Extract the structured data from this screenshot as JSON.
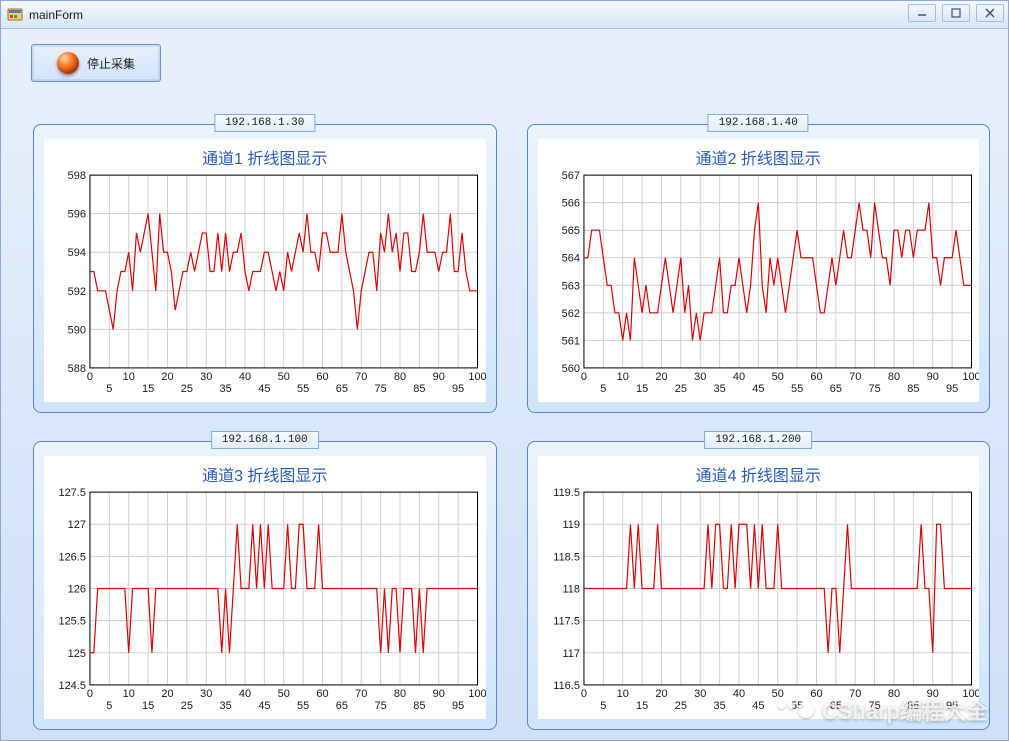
{
  "window": {
    "title": "mainForm"
  },
  "toolbar": {
    "stop_label": "停止采集"
  },
  "watermark": {
    "text": "CSharp编程大全"
  },
  "panels": [
    {
      "ip": "192.168.1.30",
      "title": "通道1 折线图显示"
    },
    {
      "ip": "192.168.1.40",
      "title": "通道2 折线图显示"
    },
    {
      "ip": "192.168.1.100",
      "title": "通道3 折线图显示"
    },
    {
      "ip": "192.168.1.200",
      "title": "通道4 折线图显示"
    }
  ],
  "chart_data": [
    {
      "type": "line",
      "title": "通道1 折线图显示",
      "xlabel": "",
      "ylabel": "",
      "xlim": [
        0,
        100
      ],
      "ylim": [
        588,
        598
      ],
      "x_ticks": [
        0,
        5,
        10,
        15,
        20,
        25,
        30,
        35,
        40,
        45,
        50,
        55,
        60,
        65,
        70,
        75,
        80,
        85,
        90,
        95,
        100
      ],
      "y_ticks": [
        588,
        590,
        592,
        594,
        596,
        598
      ],
      "x": [
        0,
        1,
        2,
        3,
        4,
        5,
        6,
        7,
        8,
        9,
        10,
        11,
        12,
        13,
        14,
        15,
        16,
        17,
        18,
        19,
        20,
        21,
        22,
        23,
        24,
        25,
        26,
        27,
        28,
        29,
        30,
        31,
        32,
        33,
        34,
        35,
        36,
        37,
        38,
        39,
        40,
        41,
        42,
        43,
        44,
        45,
        46,
        47,
        48,
        49,
        50,
        51,
        52,
        53,
        54,
        55,
        56,
        57,
        58,
        59,
        60,
        61,
        62,
        63,
        64,
        65,
        66,
        67,
        68,
        69,
        70,
        71,
        72,
        73,
        74,
        75,
        76,
        77,
        78,
        79,
        80,
        81,
        82,
        83,
        84,
        85,
        86,
        87,
        88,
        89,
        90,
        91,
        92,
        93,
        94,
        95,
        96,
        97,
        98,
        99,
        100
      ],
      "values": [
        593,
        593,
        592,
        592,
        592,
        591,
        590,
        592,
        593,
        593,
        594,
        592,
        595,
        594,
        595,
        596,
        594,
        592,
        596,
        594,
        594,
        593,
        591,
        592,
        593,
        593,
        594,
        593,
        594,
        595,
        595,
        593,
        593,
        595,
        593,
        595,
        593,
        594,
        594,
        595,
        593,
        592,
        593,
        593,
        593,
        594,
        594,
        593,
        592,
        593,
        592,
        594,
        593,
        594,
        595,
        594,
        596,
        594,
        594,
        593,
        595,
        595,
        594,
        594,
        594,
        596,
        594,
        593,
        592,
        590,
        592,
        593,
        594,
        594,
        592,
        595,
        594,
        596,
        594,
        595,
        593,
        595,
        595,
        593,
        593,
        594,
        596,
        594,
        594,
        594,
        593,
        594,
        594,
        596,
        593,
        593,
        595,
        593,
        592,
        592,
        592
      ]
    },
    {
      "type": "line",
      "title": "通道2 折线图显示",
      "xlabel": "",
      "ylabel": "",
      "xlim": [
        0,
        100
      ],
      "ylim": [
        560,
        567
      ],
      "x_ticks": [
        0,
        5,
        10,
        15,
        20,
        25,
        30,
        35,
        40,
        45,
        50,
        55,
        60,
        65,
        70,
        75,
        80,
        85,
        90,
        95,
        100
      ],
      "y_ticks": [
        560,
        561,
        562,
        563,
        564,
        565,
        566,
        567
      ],
      "x": [
        0,
        1,
        2,
        3,
        4,
        5,
        6,
        7,
        8,
        9,
        10,
        11,
        12,
        13,
        14,
        15,
        16,
        17,
        18,
        19,
        20,
        21,
        22,
        23,
        24,
        25,
        26,
        27,
        28,
        29,
        30,
        31,
        32,
        33,
        34,
        35,
        36,
        37,
        38,
        39,
        40,
        41,
        42,
        43,
        44,
        45,
        46,
        47,
        48,
        49,
        50,
        51,
        52,
        53,
        54,
        55,
        56,
        57,
        58,
        59,
        60,
        61,
        62,
        63,
        64,
        65,
        66,
        67,
        68,
        69,
        70,
        71,
        72,
        73,
        74,
        75,
        76,
        77,
        78,
        79,
        80,
        81,
        82,
        83,
        84,
        85,
        86,
        87,
        88,
        89,
        90,
        91,
        92,
        93,
        94,
        95,
        96,
        97,
        98,
        99,
        100
      ],
      "values": [
        564,
        564,
        565,
        565,
        565,
        564,
        563,
        563,
        562,
        562,
        561,
        562,
        561,
        564,
        563,
        562,
        563,
        562,
        562,
        562,
        563,
        564,
        563,
        562,
        563,
        564,
        562,
        563,
        561,
        562,
        561,
        562,
        562,
        562,
        563,
        564,
        562,
        562,
        563,
        563,
        564,
        563,
        562,
        563,
        565,
        566,
        563,
        562,
        564,
        563,
        564,
        563,
        562,
        563,
        564,
        565,
        564,
        564,
        564,
        564,
        563,
        562,
        562,
        563,
        564,
        563,
        564,
        565,
        564,
        564,
        565,
        566,
        565,
        565,
        564,
        566,
        565,
        564,
        564,
        563,
        565,
        565,
        564,
        565,
        565,
        564,
        565,
        565,
        565,
        566,
        564,
        564,
        563,
        564,
        564,
        564,
        565,
        564,
        563,
        563,
        563
      ]
    },
    {
      "type": "line",
      "title": "通道3 折线图显示",
      "xlabel": "",
      "ylabel": "",
      "xlim": [
        0,
        100
      ],
      "ylim": [
        124.5,
        127.5
      ],
      "x_ticks": [
        0,
        5,
        10,
        15,
        20,
        25,
        30,
        35,
        40,
        45,
        50,
        55,
        60,
        65,
        70,
        75,
        80,
        85,
        90,
        95,
        100
      ],
      "y_ticks": [
        124.5,
        125,
        125.5,
        126,
        126.5,
        127,
        127.5
      ],
      "x": [
        0,
        1,
        2,
        3,
        4,
        5,
        6,
        7,
        8,
        9,
        10,
        11,
        12,
        13,
        14,
        15,
        16,
        17,
        18,
        19,
        20,
        21,
        22,
        23,
        24,
        25,
        26,
        27,
        28,
        29,
        30,
        31,
        32,
        33,
        34,
        35,
        36,
        37,
        38,
        39,
        40,
        41,
        42,
        43,
        44,
        45,
        46,
        47,
        48,
        49,
        50,
        51,
        52,
        53,
        54,
        55,
        56,
        57,
        58,
        59,
        60,
        61,
        62,
        63,
        64,
        65,
        66,
        67,
        68,
        69,
        70,
        71,
        72,
        73,
        74,
        75,
        76,
        77,
        78,
        79,
        80,
        81,
        82,
        83,
        84,
        85,
        86,
        87,
        88,
        89,
        90,
        91,
        92,
        93,
        94,
        95,
        96,
        97,
        98,
        99,
        100
      ],
      "values": [
        125,
        125,
        126,
        126,
        126,
        126,
        126,
        126,
        126,
        126,
        125,
        126,
        126,
        126,
        126,
        126,
        125,
        126,
        126,
        126,
        126,
        126,
        126,
        126,
        126,
        126,
        126,
        126,
        126,
        126,
        126,
        126,
        126,
        126,
        125,
        126,
        125,
        126,
        127,
        126,
        126,
        126,
        127,
        126,
        127,
        126,
        127,
        126,
        126,
        126,
        126,
        127,
        126,
        126,
        127,
        127,
        126,
        126,
        126,
        127,
        126,
        126,
        126,
        126,
        126,
        126,
        126,
        126,
        126,
        126,
        126,
        126,
        126,
        126,
        126,
        125,
        126,
        125,
        126,
        126,
        125,
        126,
        126,
        126,
        125,
        126,
        125,
        126,
        126,
        126,
        126,
        126,
        126,
        126,
        126,
        126,
        126,
        126,
        126,
        126,
        126
      ]
    },
    {
      "type": "line",
      "title": "通道4 折线图显示",
      "xlabel": "",
      "ylabel": "",
      "xlim": [
        0,
        100
      ],
      "ylim": [
        116.5,
        119.5
      ],
      "x_ticks": [
        0,
        5,
        10,
        15,
        20,
        25,
        30,
        35,
        40,
        45,
        50,
        55,
        60,
        65,
        70,
        75,
        80,
        85,
        90,
        95,
        100
      ],
      "y_ticks": [
        116.5,
        117,
        117.5,
        118,
        118.5,
        119,
        119.5
      ],
      "x": [
        0,
        1,
        2,
        3,
        4,
        5,
        6,
        7,
        8,
        9,
        10,
        11,
        12,
        13,
        14,
        15,
        16,
        17,
        18,
        19,
        20,
        21,
        22,
        23,
        24,
        25,
        26,
        27,
        28,
        29,
        30,
        31,
        32,
        33,
        34,
        35,
        36,
        37,
        38,
        39,
        40,
        41,
        42,
        43,
        44,
        45,
        46,
        47,
        48,
        49,
        50,
        51,
        52,
        53,
        54,
        55,
        56,
        57,
        58,
        59,
        60,
        61,
        62,
        63,
        64,
        65,
        66,
        67,
        68,
        69,
        70,
        71,
        72,
        73,
        74,
        75,
        76,
        77,
        78,
        79,
        80,
        81,
        82,
        83,
        84,
        85,
        86,
        87,
        88,
        89,
        90,
        91,
        92,
        93,
        94,
        95,
        96,
        97,
        98,
        99,
        100
      ],
      "values": [
        118,
        118,
        118,
        118,
        118,
        118,
        118,
        118,
        118,
        118,
        118,
        118,
        119,
        118,
        119,
        118,
        118,
        118,
        118,
        119,
        118,
        118,
        118,
        118,
        118,
        118,
        118,
        118,
        118,
        118,
        118,
        118,
        119,
        118,
        119,
        119,
        118,
        118,
        119,
        118,
        119,
        119,
        119,
        118,
        119,
        118,
        119,
        118,
        118,
        118,
        119,
        118,
        118,
        118,
        118,
        118,
        118,
        118,
        118,
        118,
        118,
        118,
        118,
        117,
        118,
        118,
        117,
        118,
        119,
        118,
        118,
        118,
        118,
        118,
        118,
        118,
        118,
        118,
        118,
        118,
        118,
        118,
        118,
        118,
        118,
        118,
        118,
        119,
        118,
        118,
        117,
        119,
        119,
        118,
        118,
        118,
        118,
        118,
        118,
        118,
        118
      ]
    }
  ]
}
